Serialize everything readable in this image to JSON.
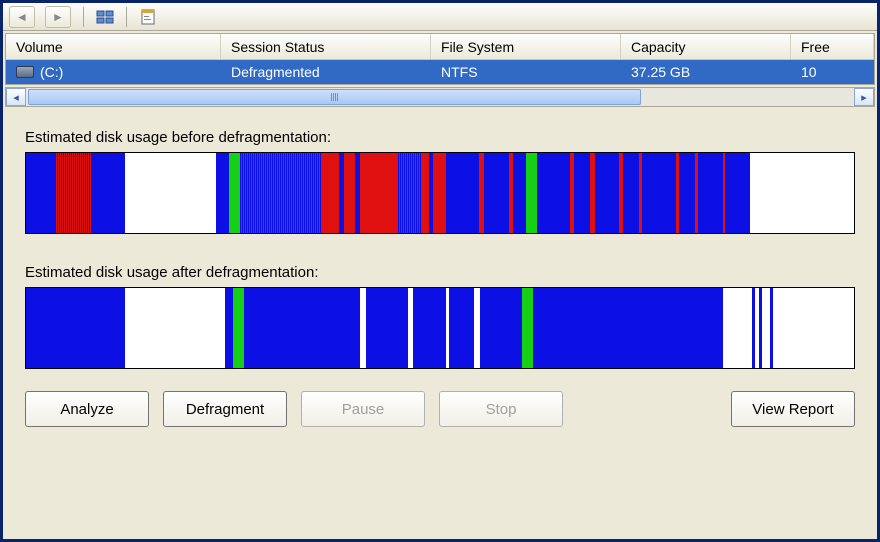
{
  "columns": {
    "volume": "Volume",
    "status": "Session Status",
    "filesystem": "File System",
    "capacity": "Capacity",
    "free": "Free"
  },
  "row": {
    "volume": "(C:)",
    "status": "Defragmented",
    "filesystem": "NTFS",
    "capacity": "37.25 GB",
    "free": "10"
  },
  "labels": {
    "before": "Estimated disk usage before defragmentation:",
    "after": "Estimated disk usage after defragmentation:"
  },
  "buttons": {
    "analyze": "Analyze",
    "defragment": "Defragment",
    "pause": "Pause",
    "stop": "Stop",
    "view_report": "View Report"
  },
  "legend_colors": {
    "contiguous": "#0c10e4",
    "fragmented": "#e01010",
    "unmovable": "#15d015",
    "free": "#ffffff"
  },
  "chart_data": [
    {
      "type": "bar",
      "title": "Estimated disk usage before defragmentation",
      "segments": [
        {
          "kind": "blue",
          "pct": 3.5
        },
        {
          "kind": "purple",
          "pct": 4.5
        },
        {
          "kind": "blue",
          "pct": 4
        },
        {
          "kind": "white",
          "pct": 11
        },
        {
          "kind": "blue",
          "pct": 1.5
        },
        {
          "kind": "green",
          "pct": 1.3
        },
        {
          "kind": "purple",
          "pct": 10
        },
        {
          "kind": "red",
          "pct": 2
        },
        {
          "kind": "blue",
          "pct": 0.6
        },
        {
          "kind": "red",
          "pct": 1.4
        },
        {
          "kind": "blue",
          "pct": 0.6
        },
        {
          "kind": "red",
          "pct": 4.5
        },
        {
          "kind": "purple",
          "pct": 3
        },
        {
          "kind": "red",
          "pct": 0.8
        },
        {
          "kind": "blue",
          "pct": 0.5
        },
        {
          "kind": "red",
          "pct": 1.5
        },
        {
          "kind": "blue",
          "pct": 4
        },
        {
          "kind": "red",
          "pct": 0.6
        },
        {
          "kind": "blue",
          "pct": 3
        },
        {
          "kind": "red",
          "pct": 0.6
        },
        {
          "kind": "blue",
          "pct": 1.5
        },
        {
          "kind": "green",
          "pct": 1.3
        },
        {
          "kind": "blue",
          "pct": 4
        },
        {
          "kind": "red",
          "pct": 0.5
        },
        {
          "kind": "blue",
          "pct": 2
        },
        {
          "kind": "red",
          "pct": 0.5
        },
        {
          "kind": "blue",
          "pct": 3
        },
        {
          "kind": "red",
          "pct": 0.4
        },
        {
          "kind": "blue",
          "pct": 2
        },
        {
          "kind": "red",
          "pct": 0.4
        },
        {
          "kind": "blue",
          "pct": 4
        },
        {
          "kind": "red",
          "pct": 0.4
        },
        {
          "kind": "blue",
          "pct": 2
        },
        {
          "kind": "red",
          "pct": 0.3
        },
        {
          "kind": "blue",
          "pct": 3
        },
        {
          "kind": "red",
          "pct": 0.3
        },
        {
          "kind": "blue",
          "pct": 3
        },
        {
          "kind": "white",
          "pct": 9
        }
      ]
    },
    {
      "type": "bar",
      "title": "Estimated disk usage after defragmentation",
      "segments": [
        {
          "kind": "blue",
          "pct": 12
        },
        {
          "kind": "white",
          "pct": 12
        },
        {
          "kind": "blue",
          "pct": 1
        },
        {
          "kind": "green",
          "pct": 1.3
        },
        {
          "kind": "blue",
          "pct": 14
        },
        {
          "kind": "white",
          "pct": 0.8
        },
        {
          "kind": "blue",
          "pct": 5
        },
        {
          "kind": "white",
          "pct": 0.6
        },
        {
          "kind": "blue",
          "pct": 4
        },
        {
          "kind": "white",
          "pct": 0.4
        },
        {
          "kind": "blue",
          "pct": 3
        },
        {
          "kind": "white",
          "pct": 0.8
        },
        {
          "kind": "blue",
          "pct": 5
        },
        {
          "kind": "green",
          "pct": 1.3
        },
        {
          "kind": "blue",
          "pct": 23
        },
        {
          "kind": "white",
          "pct": 3.5
        },
        {
          "kind": "blue",
          "pct": 0.4
        },
        {
          "kind": "white",
          "pct": 0.4
        },
        {
          "kind": "blue",
          "pct": 0.4
        },
        {
          "kind": "white",
          "pct": 1
        },
        {
          "kind": "blue",
          "pct": 0.4
        },
        {
          "kind": "white",
          "pct": 9
        }
      ]
    }
  ]
}
